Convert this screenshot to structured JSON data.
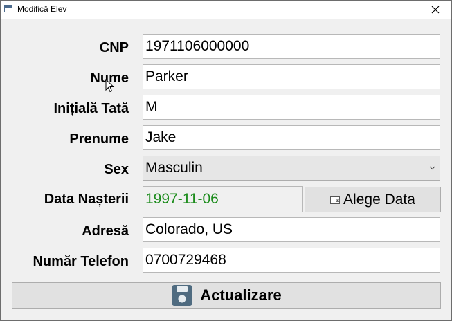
{
  "window": {
    "title": "Modifică Elev",
    "close_icon": "close-icon"
  },
  "form": {
    "cnp": {
      "label": "CNP",
      "value": "1971106000000"
    },
    "nume": {
      "label": "Nume",
      "value": "Parker"
    },
    "initiala": {
      "label": "Inițială Tată",
      "value": "M"
    },
    "prenume": {
      "label": "Prenume",
      "value": "Jake"
    },
    "sex": {
      "label": "Sex",
      "value": "Masculin"
    },
    "data": {
      "label": "Data Nașterii",
      "value": "1997-11-06",
      "button_label": "Alege Data",
      "value_color": "#1c8c1c"
    },
    "adresa": {
      "label": "Adresă",
      "value": "Colorado, US"
    },
    "telefon": {
      "label": "Număr Telefon",
      "value": "0700729468"
    }
  },
  "actions": {
    "update_label": "Actualizare",
    "update_icon": "save-icon"
  }
}
